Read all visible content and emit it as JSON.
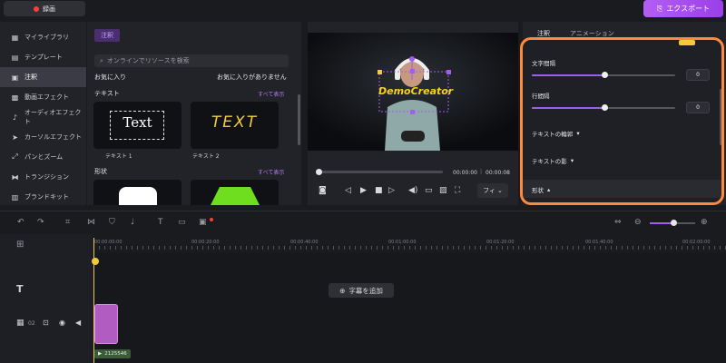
{
  "topbar": {
    "record_label": "録画",
    "export_label": "エクスポート"
  },
  "sidebar": {
    "items": [
      {
        "icon": "library-icon",
        "label": "マイライブラリ"
      },
      {
        "icon": "template-icon",
        "label": "テンプレート"
      },
      {
        "icon": "caption-icon",
        "label": "注釈"
      },
      {
        "icon": "effect-icon",
        "label": "動画エフェクト"
      },
      {
        "icon": "audio-icon",
        "label": "オーディオエフェクト"
      },
      {
        "icon": "cursor-icon",
        "label": "カーソルエフェクト"
      },
      {
        "icon": "pan-zoom-icon",
        "label": "パンとズーム"
      },
      {
        "icon": "transition-icon",
        "label": "トランジション"
      },
      {
        "icon": "brand-icon",
        "label": "ブランドキット"
      }
    ]
  },
  "library": {
    "tab": "注釈",
    "search_placeholder": "オンラインでリソースを検索",
    "favorites_label": "お気に入り",
    "favorites_empty": "お気に入りがありません",
    "text_section": "テキスト",
    "shape_section": "形状",
    "show_all": "すべて表示",
    "thumb1_text": "Text",
    "thumb1_caption": "テキスト 1",
    "thumb2_text": "TEXT",
    "thumb2_caption": "テキスト 2"
  },
  "preview": {
    "overlay_text": "DemoCreator",
    "time_current": "00:00:00",
    "time_total": "00:00:08",
    "fit_label": "フィ"
  },
  "inspector": {
    "tab_caption": "注釈",
    "tab_animation": "アニメーション",
    "letter_spacing_label": "文字間隔",
    "letter_spacing_value": "0",
    "line_spacing_label": "行間隔",
    "line_spacing_value": "0",
    "outline_label": "テキストの輪郭",
    "shadow_label": "テキストの影",
    "shape_label": "形状"
  },
  "timeline": {
    "ticks": [
      "00:00:00:00",
      "00:00:20:00",
      "00:00:40:00",
      "00:01:00:00",
      "00:01:20:00",
      "00:01:40:00",
      "00:02:00:00"
    ],
    "add_subtitle_label": "字幕を追加",
    "track_number": "02",
    "clip_label": "2125546"
  },
  "colors": {
    "accent": "#a15cf0",
    "highlight": "#ff8a3d",
    "playhead": "#f0c93d"
  }
}
